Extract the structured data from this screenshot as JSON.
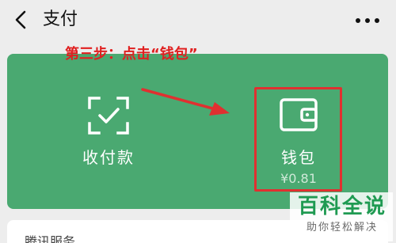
{
  "nav": {
    "title": "支付",
    "back_icon": "chevron-left-icon",
    "more_icon": "more-dots-icon"
  },
  "pay_card": {
    "background": "#4aa971",
    "collect": {
      "label": "收付款",
      "icon": "scan-qr-icon"
    },
    "wallet": {
      "label": "钱包",
      "balance": "¥0.81",
      "icon": "wallet-icon"
    }
  },
  "annotation": {
    "step_text": "第三步：点击“钱包”",
    "color": "#e02020"
  },
  "lower_card": {
    "text": "腾讯服务"
  },
  "watermark": {
    "main": "百科全说",
    "sub": "助你轻松解决"
  }
}
